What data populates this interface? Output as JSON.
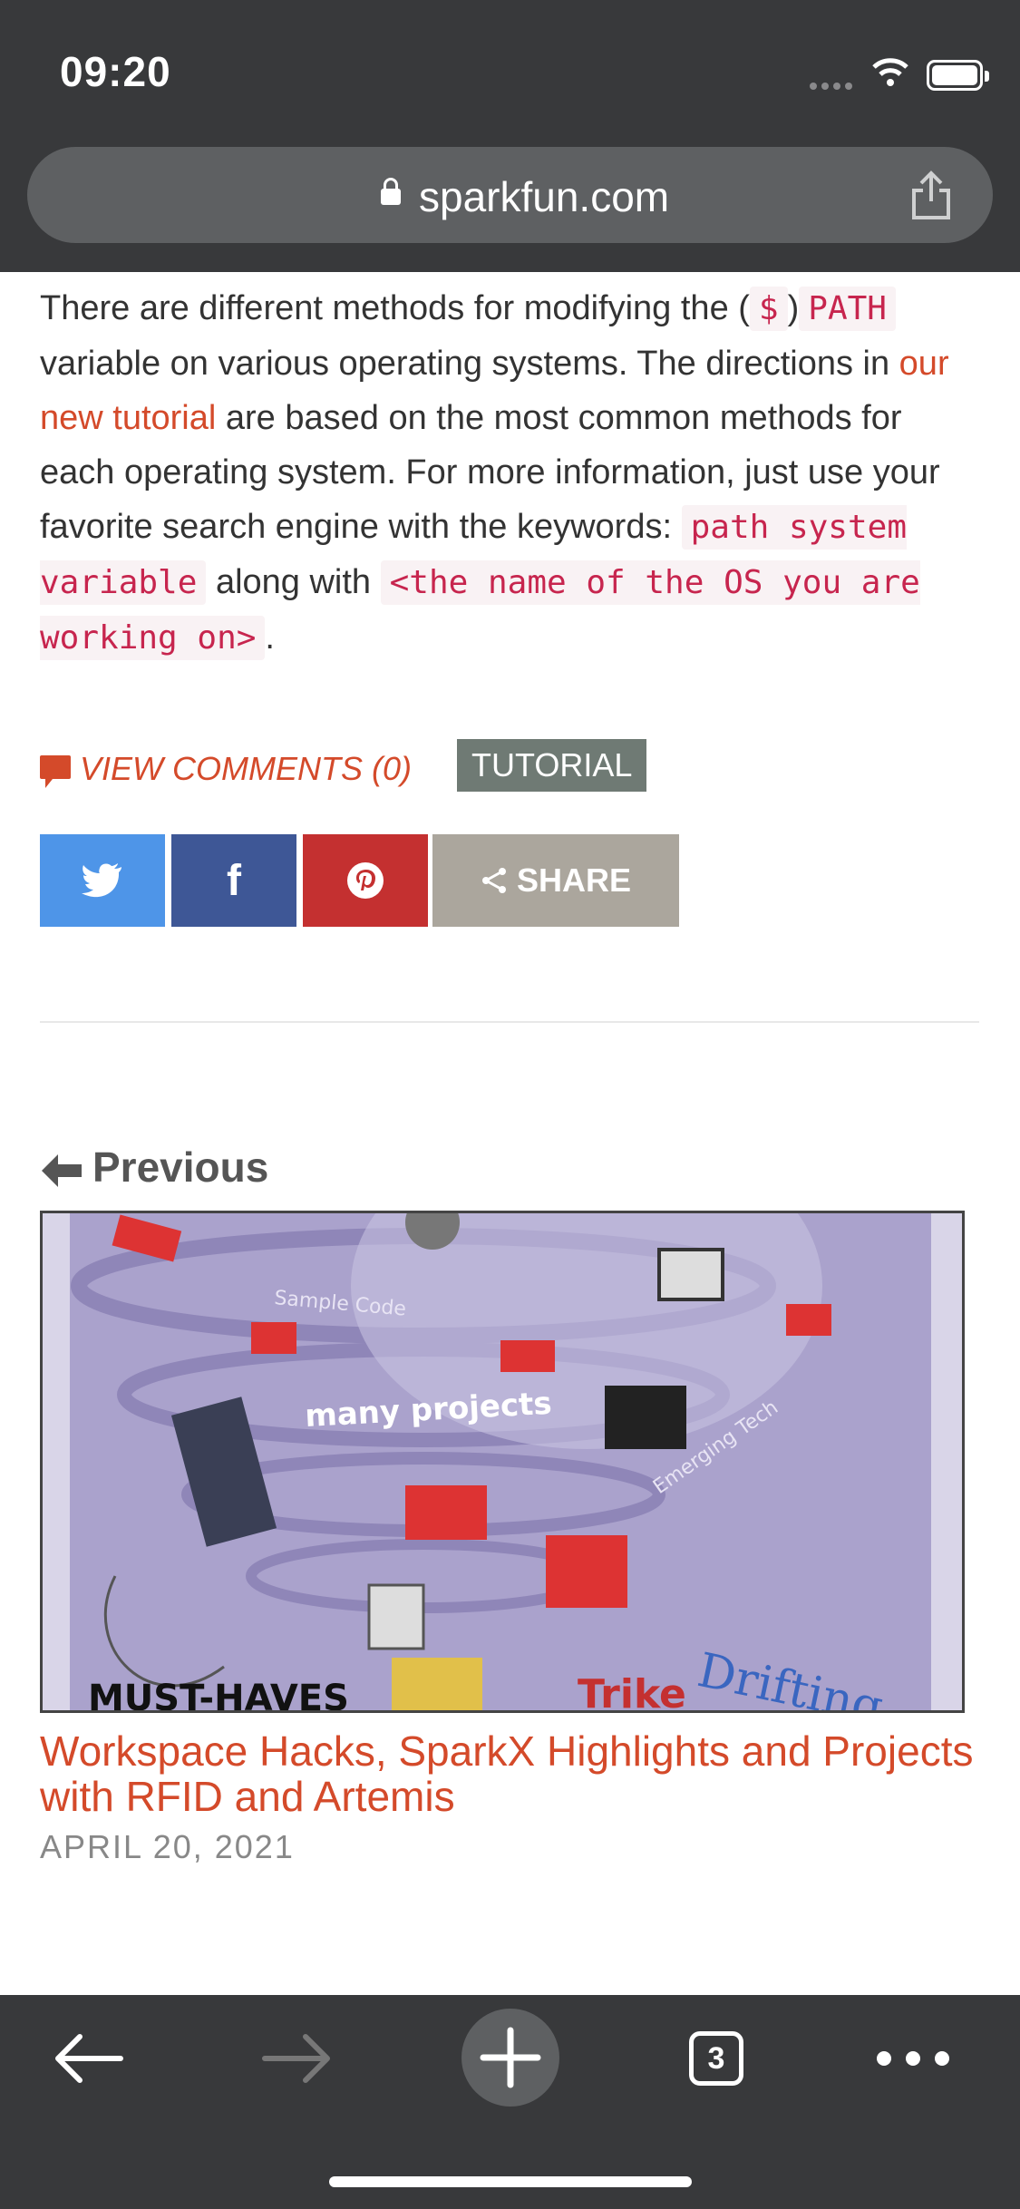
{
  "status_bar": {
    "time": "09:20"
  },
  "browser": {
    "domain": "sparkfun.com"
  },
  "article": {
    "p1_a": "There are different methods for modifying the (",
    "p1_b": "$",
    "p1_c": ")",
    "p1_d": "PATH",
    "p1_e": " variable on various operating systems. The directions in ",
    "p1_link": "our new tutorial",
    "p1_f": " are based on the most common methods for each operating system. For more information, just use your favorite search engine with the keywords: ",
    "p1_code1": "path system variable",
    "p1_g": " along with ",
    "p1_code2": "<the name of the OS you are working on>",
    "p1_h": "."
  },
  "meta": {
    "comments": "VIEW COMMENTS (0)",
    "tag": "TUTORIAL"
  },
  "share": {
    "share_label": "SHARE",
    "facebook_glyph": "f"
  },
  "prev": {
    "label": "Previous"
  },
  "prev_post": {
    "title": "Workspace Hacks, SparkX Highlights and Projects with RFID and Artemis",
    "date": "APRIL 20, 2021",
    "image_texts": [
      "Sample Code",
      "many projects",
      "Emerging Tech",
      "Drifting",
      "Trike",
      "MUST-HAVES"
    ]
  },
  "toolbar": {
    "tab_count": "3"
  },
  "colors": {
    "accent": "#d44a2a",
    "bar": "#38393b",
    "twitter": "#4e95e8",
    "facebook": "#3e5796",
    "pinterest": "#c43030",
    "share": "#aba69d",
    "tag": "#6f7a74"
  }
}
